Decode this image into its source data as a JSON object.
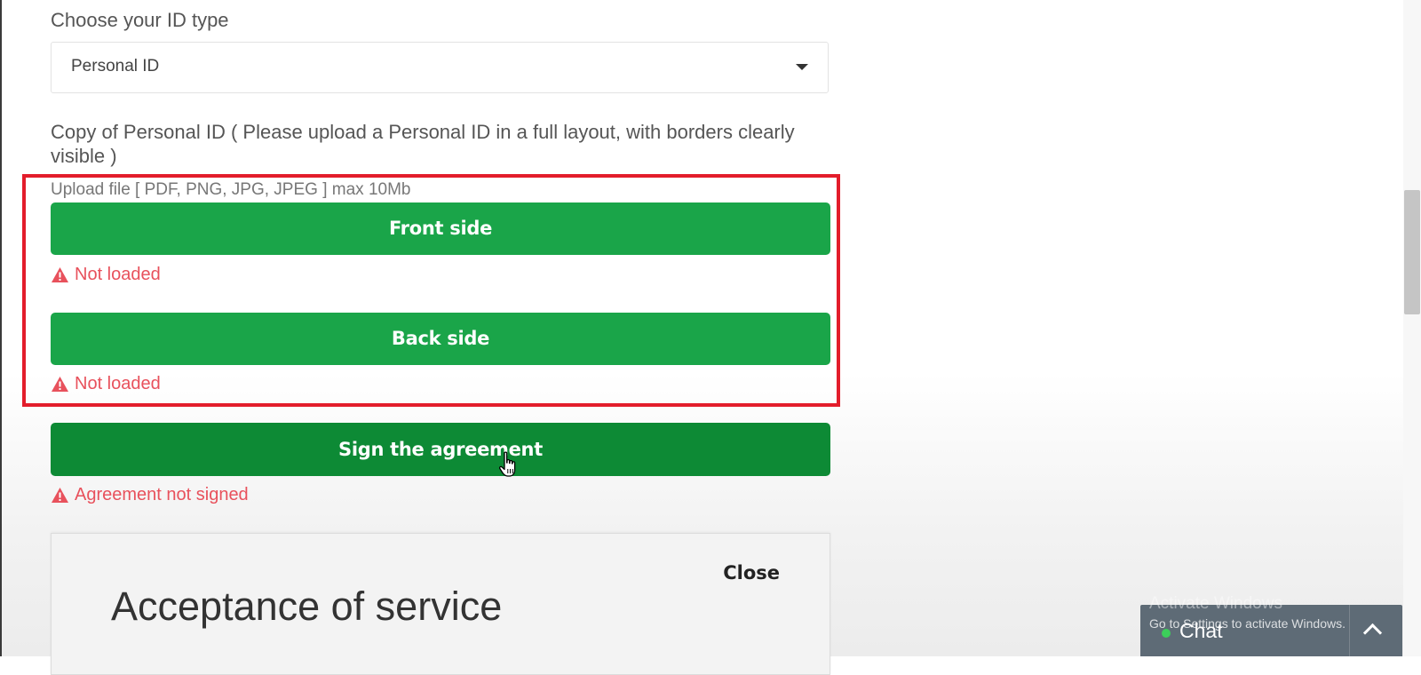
{
  "form": {
    "id_type_label": "Choose your ID type",
    "id_type_selected": "Personal ID",
    "copy_label": "Copy of Personal ID ( Please upload a Personal ID in a full layout, with borders clearly visible )",
    "upload_hint": "Upload file [ PDF, PNG, JPG, JPEG ] max 10Mb",
    "front_button": "Front side",
    "front_status": "Not loaded",
    "back_button": "Back side",
    "back_status": "Not loaded",
    "sign_button": "Sign the agreement",
    "sign_status": "Agreement not signed"
  },
  "modal": {
    "close_label": "Close",
    "title": "Acceptance of service"
  },
  "chat": {
    "label": "Chat"
  },
  "watermark": {
    "title": "Activate Windows",
    "subtitle": "Go to Settings to activate Windows."
  },
  "colors": {
    "button_green": "#1aa549",
    "button_green_hover": "#0d8a35",
    "warning_red": "#e8515c",
    "highlight_red": "#e31d2b",
    "chat_bg": "#5e6b76"
  }
}
